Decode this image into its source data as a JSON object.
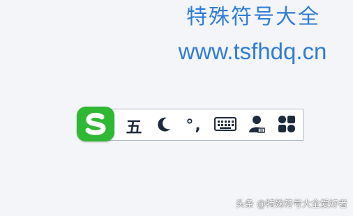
{
  "header": {
    "title": "特殊符号大全",
    "url": "www.tsfhdq.cn"
  },
  "ime_toolbar": {
    "logo_icon": "sogou-s-logo",
    "brand_color": "#2fb833",
    "input_mode": "五",
    "half_full_width_icon": "moon-icon",
    "punctuation": "°,",
    "keyboard_icon": "keyboard-icon",
    "account_icon": "user-icon",
    "toolbox_icon": "grid-icon",
    "icon_color": "#1f2b3d"
  },
  "watermark": {
    "text": "头条 @特殊符号大全爱好者"
  }
}
